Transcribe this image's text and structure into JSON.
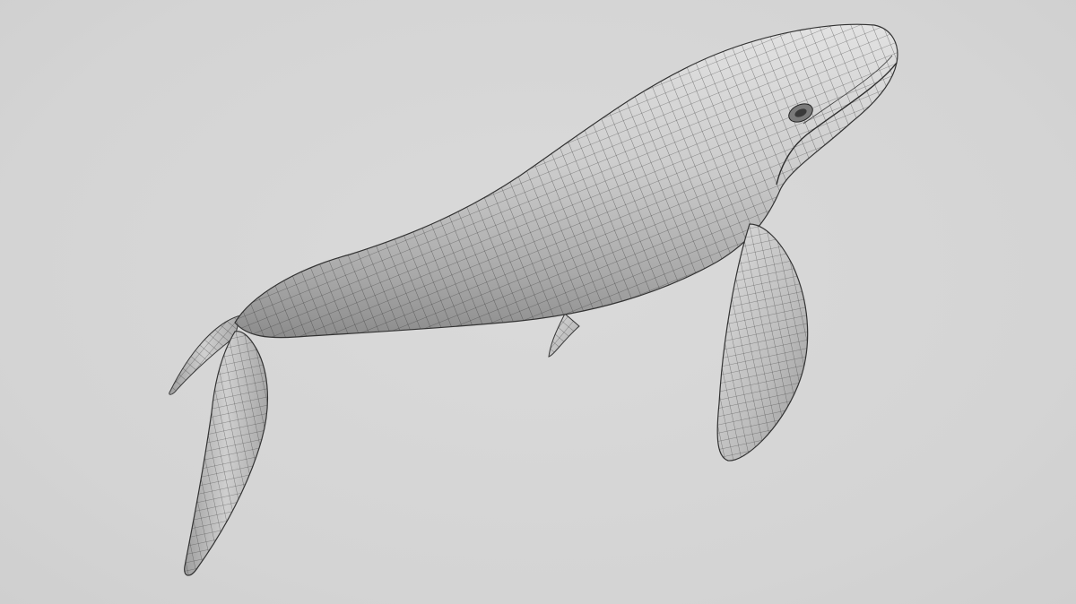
{
  "scene": {
    "subject": "whale-mesh",
    "background_color": "#d6d6d6",
    "mesh_fill_color": "#c9c9c9",
    "wire_color": "#2a2a2a",
    "shadow_color": "#8e8e8e"
  }
}
